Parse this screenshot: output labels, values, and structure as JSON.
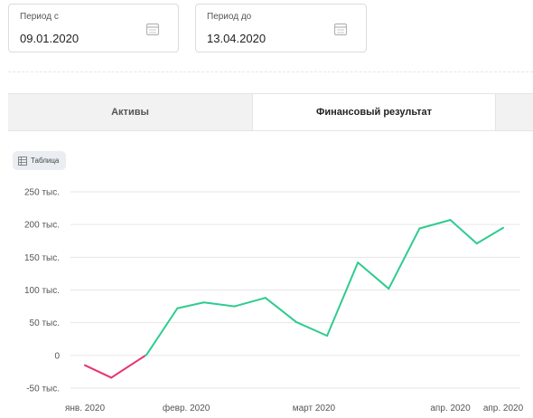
{
  "filters": {
    "from": {
      "label": "Период с",
      "value": "09.01.2020",
      "icon": "calendar-icon"
    },
    "to": {
      "label": "Период до",
      "value": "13.04.2020",
      "icon": "calendar-icon"
    }
  },
  "tabs": [
    {
      "label": "Активы",
      "active": false
    },
    {
      "label": "Финансовый результат",
      "active": true
    }
  ],
  "table_toggle": {
    "label": "Таблица",
    "icon": "table-icon"
  },
  "colors": {
    "positive": "#2ecc8f",
    "negative": "#e8336d",
    "grid": "#e6e6e6"
  },
  "chart_data": {
    "type": "line",
    "y_ticks": [
      -50000,
      0,
      50000,
      100000,
      150000,
      200000,
      250000
    ],
    "y_tick_labels": [
      "-50 тыс.",
      "0",
      "50 тыс.",
      "100 тыс.",
      "150 тыс.",
      "200 тыс.",
      "250 тыс."
    ],
    "ylim": [
      -50000,
      250000
    ],
    "x_tick_labels": [
      "янв. 2020",
      "февр. 2020",
      "март 2020",
      "апр. 2020",
      "апр. 2020"
    ],
    "x_tick_dates": [
      "2020-01-09",
      "2020-02-01",
      "2020-03-01",
      "2020-04-01",
      "2020-04-13"
    ],
    "x": [
      "2020-01-09",
      "2020-01-15",
      "2020-01-23",
      "2020-01-30",
      "2020-02-05",
      "2020-02-12",
      "2020-02-19",
      "2020-02-26",
      "2020-03-04",
      "2020-03-11",
      "2020-03-18",
      "2020-03-25",
      "2020-04-01",
      "2020-04-07",
      "2020-04-13"
    ],
    "values": [
      -15000,
      -34000,
      1000,
      72000,
      81000,
      75000,
      88000,
      51000,
      30000,
      142000,
      102000,
      194000,
      207000,
      171000,
      195000
    ],
    "grid": true,
    "legend": "none"
  }
}
